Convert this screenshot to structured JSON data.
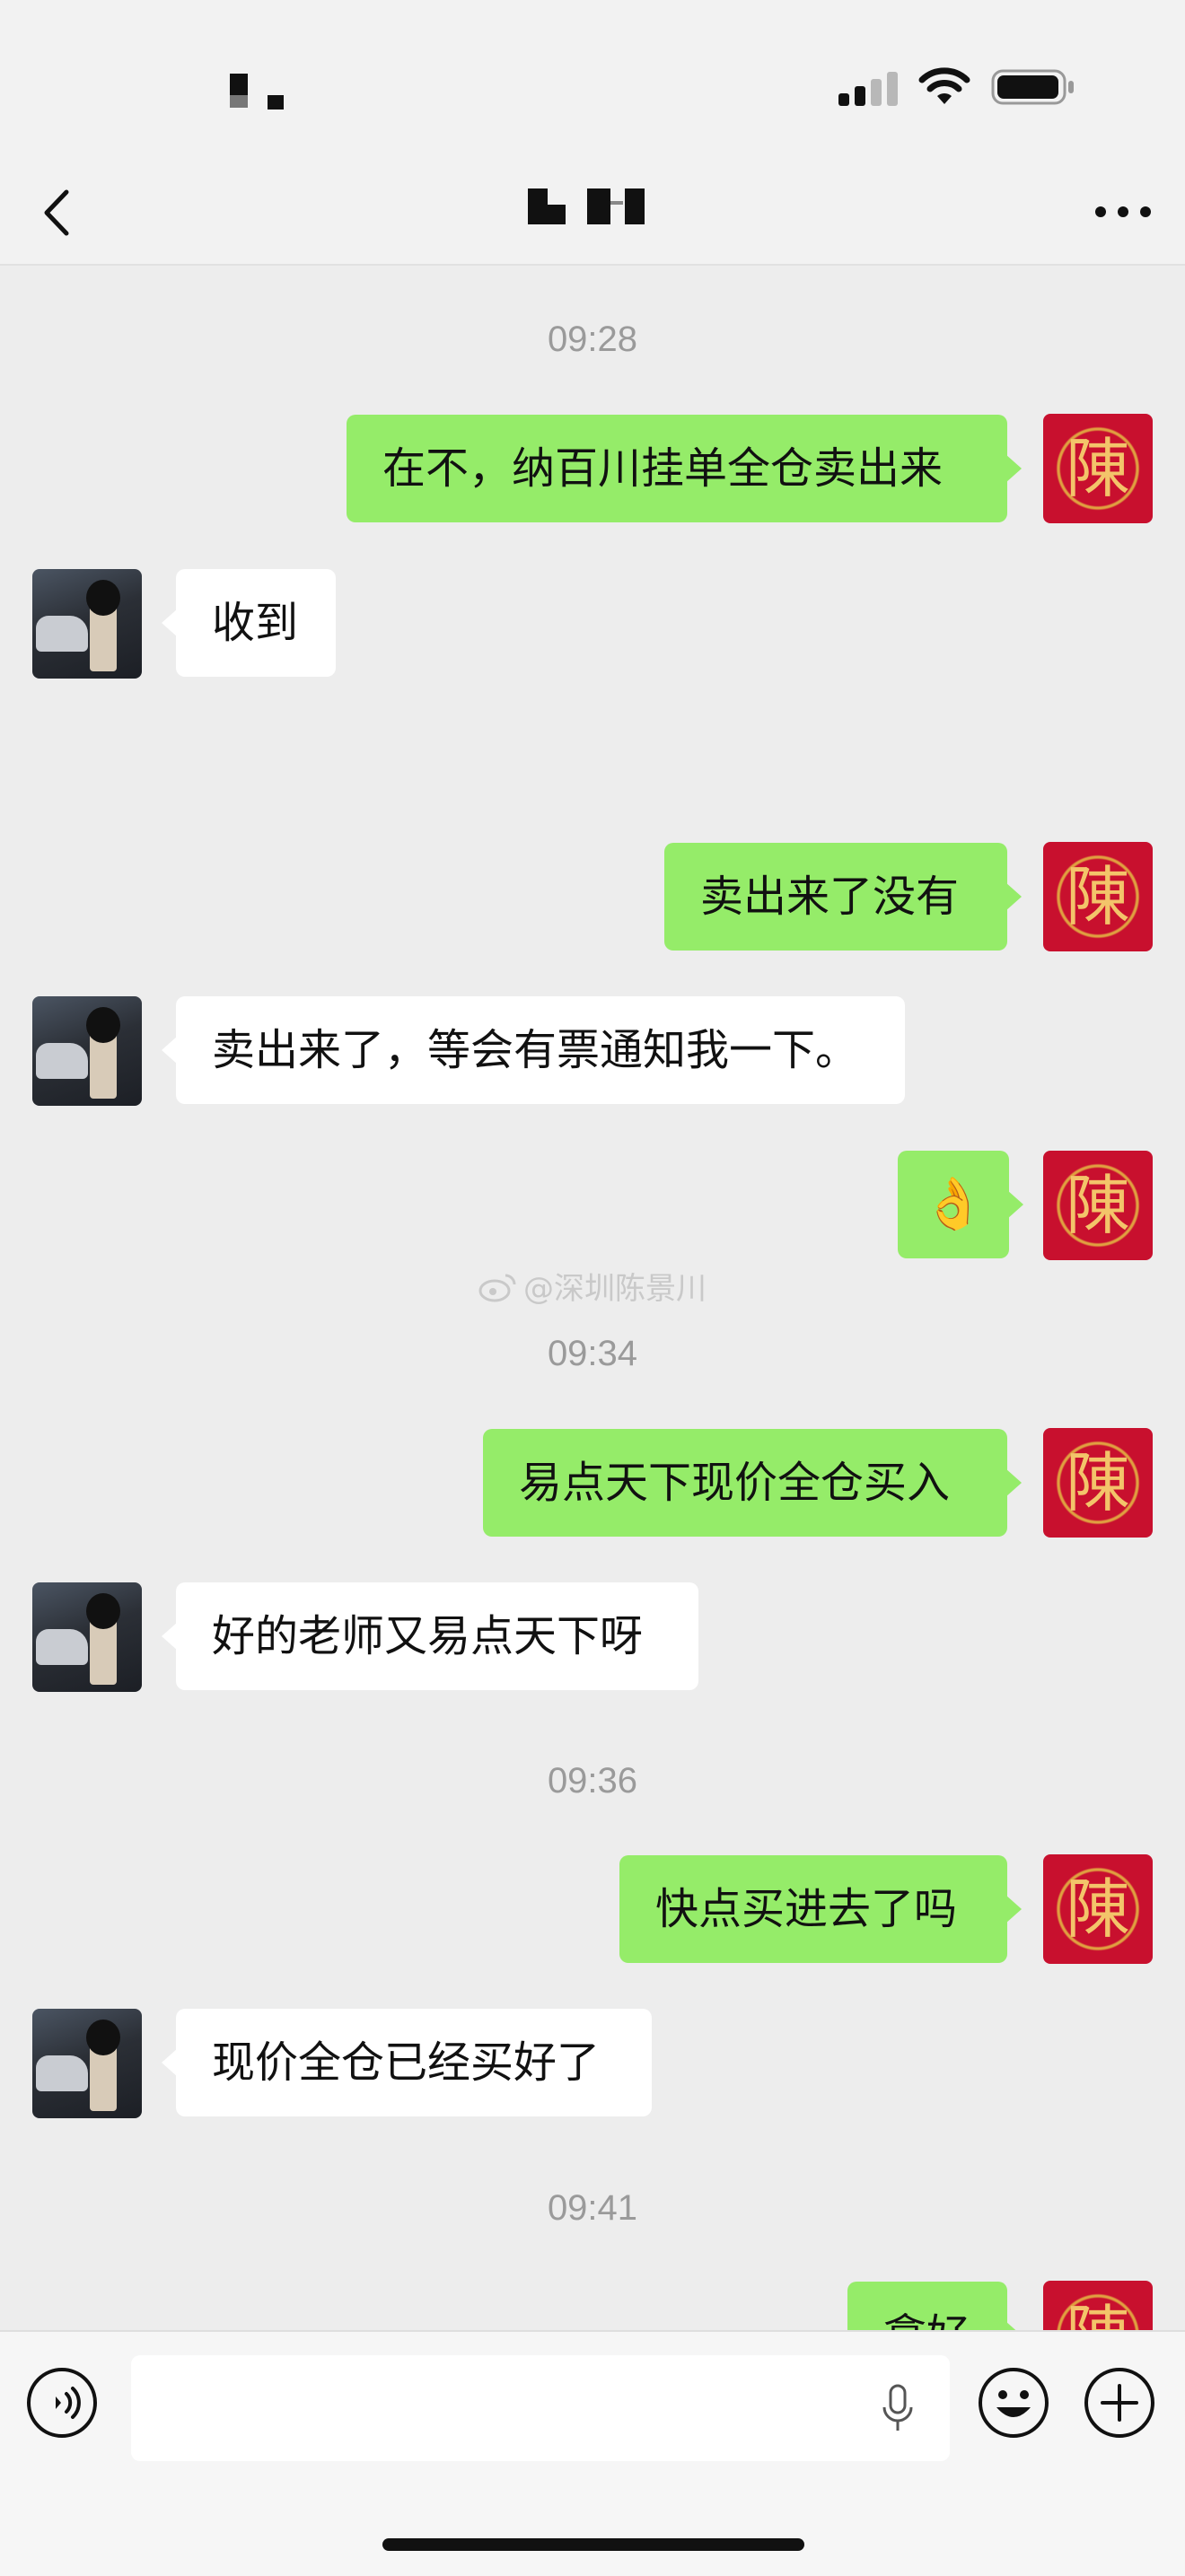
{
  "header": {
    "back_icon": "chevron-left-icon",
    "more_icon": "ellipsis-icon"
  },
  "messages": [
    {
      "type": "timestamp",
      "text": "09:28"
    },
    {
      "type": "sent",
      "text": "在不，纳百川挂单全仓卖出来"
    },
    {
      "type": "received",
      "text": "收到"
    },
    {
      "type": "sent",
      "text": "卖出来了没有"
    },
    {
      "type": "received",
      "text": "卖出来了，等会有票通知我一下。"
    },
    {
      "type": "sent",
      "text": "👌"
    },
    {
      "type": "timestamp",
      "text": "09:34"
    },
    {
      "type": "sent",
      "text": "易点天下现价全仓买入"
    },
    {
      "type": "received",
      "text": "好的老师又易点天下呀"
    },
    {
      "type": "timestamp",
      "text": "09:36"
    },
    {
      "type": "sent",
      "text": "快点买进去了吗"
    },
    {
      "type": "received",
      "text": "现价全仓已经买好了"
    },
    {
      "type": "timestamp",
      "text": "09:41"
    },
    {
      "type": "sent",
      "text": "拿好"
    }
  ],
  "my_avatar_char": "陳",
  "watermark": "@深圳陈景川",
  "input_bar": {
    "voice_icon": "voice-icon",
    "mic_icon": "mic-icon",
    "emoji_icon": "smiley-icon",
    "plus_icon": "plus-icon"
  },
  "colors": {
    "sent_bubble": "#95ec69",
    "received_bubble": "#ffffff",
    "background": "#ededed"
  }
}
